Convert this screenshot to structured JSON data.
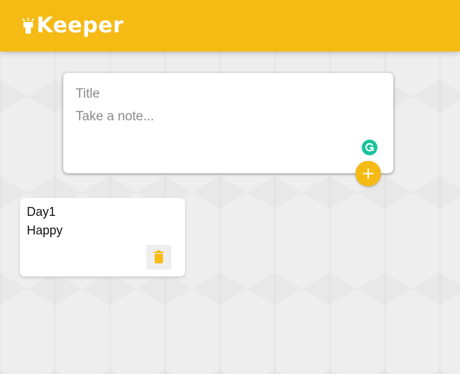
{
  "header": {
    "app_name": "Keeper",
    "logo_icon": "lightbulb-icon"
  },
  "create_area": {
    "title_placeholder": "Title",
    "title_value": "",
    "content_placeholder": "Take a note...",
    "content_value": "",
    "add_button_icon": "plus-icon",
    "extension_icon": "grammarly-icon"
  },
  "notes": [
    {
      "title": "Day1",
      "content": "Happy",
      "delete_icon": "trash-icon"
    }
  ],
  "colors": {
    "accent": "#f5ba13",
    "background": "#eeeeee",
    "card": "#ffffff",
    "grammarly": "#15c39a"
  }
}
